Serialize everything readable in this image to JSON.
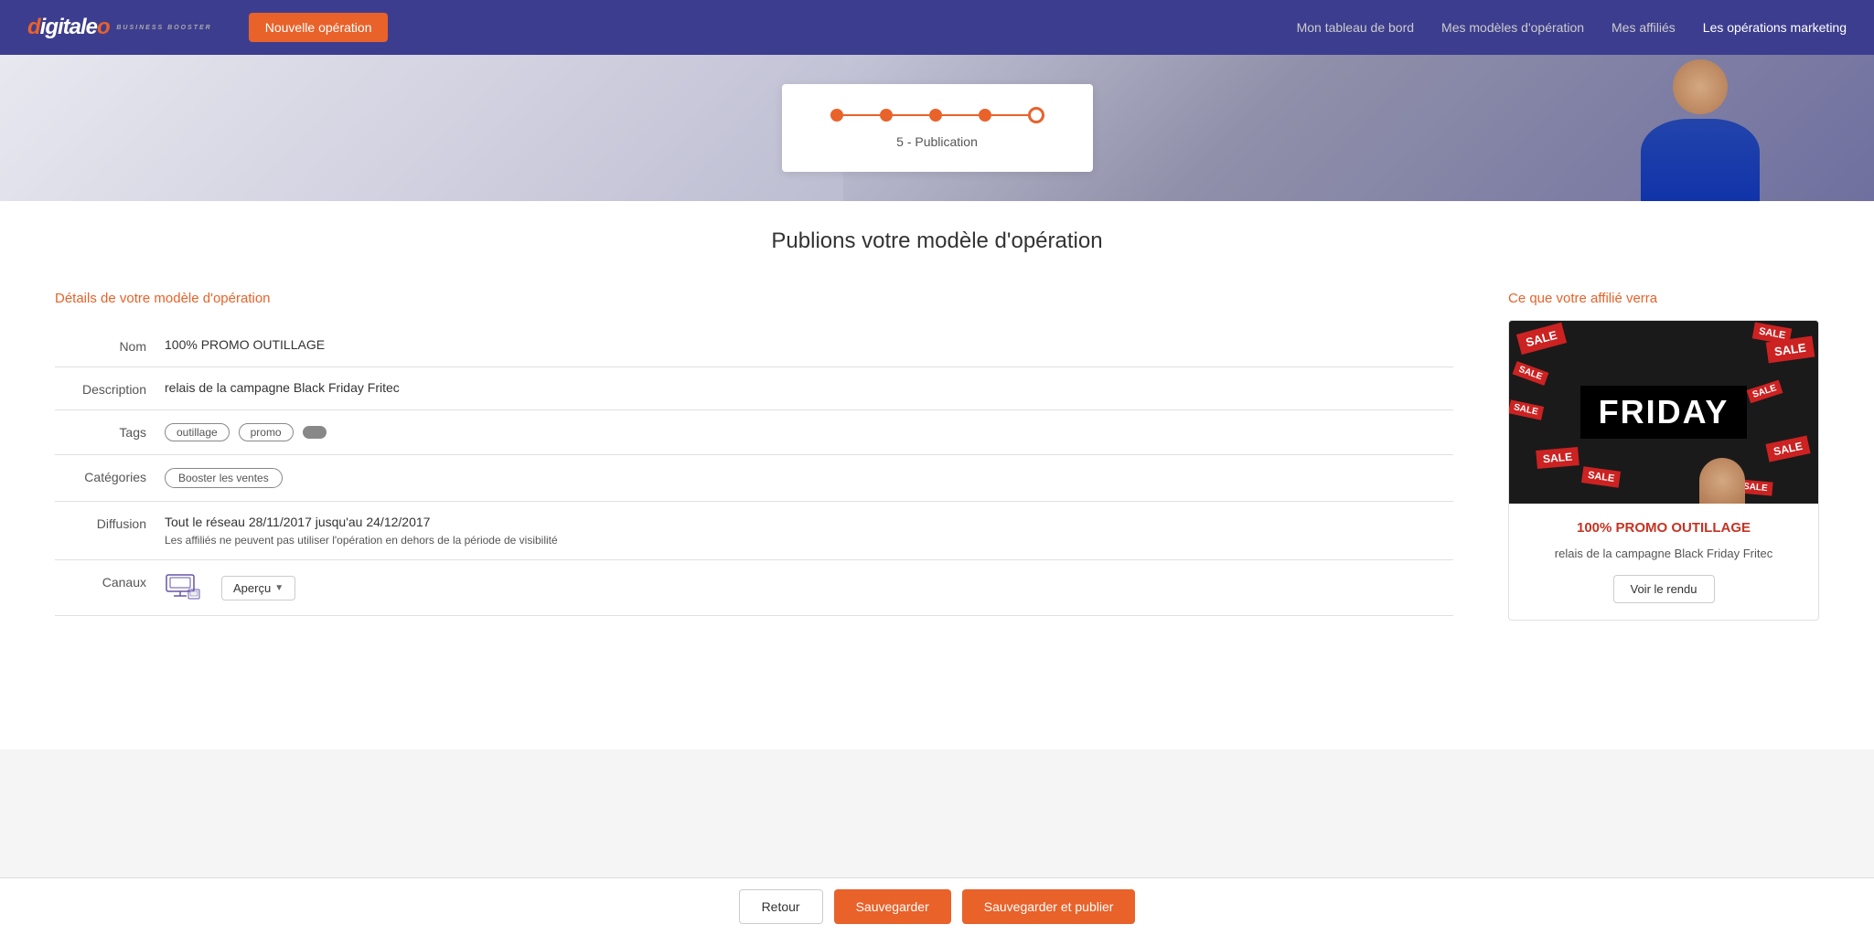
{
  "navbar": {
    "brand": "digitaleo",
    "brand_sub": "BUSINESS BOOSTER",
    "new_operation_btn": "Nouvelle opération",
    "links": [
      {
        "label": "Mon tableau de bord",
        "active": false
      },
      {
        "label": "Mes modèles d'opération",
        "active": false
      },
      {
        "label": "Mes affiliés",
        "active": false
      },
      {
        "label": "Les opérations marketing",
        "active": true
      }
    ]
  },
  "step": {
    "label": "5 - Publication",
    "dots": 5,
    "active_dot": 5
  },
  "page_title": "Publions votre modèle d'opération",
  "details": {
    "section_title": "Détails de votre modèle d'opération",
    "nom_label": "Nom",
    "nom_value": "100% PROMO OUTILLAGE",
    "description_label": "Description",
    "description_value": "relais de la campagne Black Friday Fritec",
    "tags_label": "Tags",
    "tags": [
      "outillage",
      "promo"
    ],
    "categories_label": "Catégories",
    "category": "Booster les ventes",
    "diffusion_label": "Diffusion",
    "diffusion_line1": "Tout le réseau 28/11/2017 jusqu'au 24/12/2017",
    "diffusion_line2": "Les affiliés ne peuvent pas utiliser l'opération en dehors de la période de visibilité",
    "canaux_label": "Canaux",
    "apercu_btn": "Aperçu"
  },
  "preview": {
    "section_title": "Ce que votre affilié verra",
    "image_text": "FRIDAY",
    "sale_label": "SALE",
    "name": "100% PROMO OUTILLAGE",
    "description": "relais de la campagne Black Friday Fritec",
    "voir_rendu_btn": "Voir le rendu"
  },
  "footer": {
    "retour_btn": "Retour",
    "sauvegarder_btn": "Sauvegarder",
    "publier_btn": "Sauvegarder et publier"
  }
}
